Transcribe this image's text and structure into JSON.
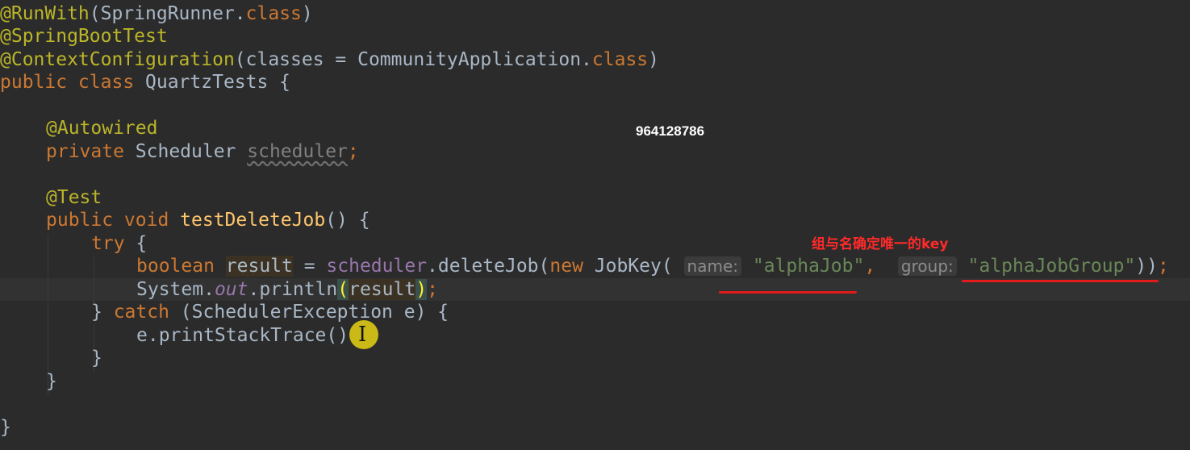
{
  "code": {
    "line1": {
      "annotation": "@RunWith",
      "open": "(SpringRunner.",
      "kw": "class",
      "close": ")"
    },
    "line2": {
      "annotation": "@SpringBootTest"
    },
    "line3": {
      "annotation": "@ContextConfiguration",
      "open": "(classes = CommunityApplication.",
      "kw": "class",
      "close": ")"
    },
    "line4": {
      "kw": "public class ",
      "name": "QuartzTests {"
    },
    "line6": {
      "annotation": "@Autowired"
    },
    "line7": {
      "kw": "private ",
      "type": "Scheduler ",
      "field": "scheduler",
      "semi": ";"
    },
    "line9": {
      "annotation": "@Test"
    },
    "line10": {
      "kw": "public void ",
      "method": "testDeleteJob",
      "rest": "() {"
    },
    "line11": {
      "kw": "try",
      "rest": " {"
    },
    "line12": {
      "kw": "boolean ",
      "var": "result",
      "eq": " = ",
      "field": "scheduler",
      "call": ".deleteJob(",
      "kw_new": "new ",
      "ctor": "JobKey( ",
      "hint_name": "name:",
      "str_name": "\"alphaJob\"",
      "comma": ",",
      "hint_group": "group:",
      "str_group": "\"alphaJobGroup\"",
      "close": "))",
      "semi": ";"
    },
    "line13": {
      "sys": "System.",
      "out": "out",
      "println": ".println",
      "lparen": "(",
      "arg": "result",
      "rparen": ")",
      "semi": ";"
    },
    "line14": {
      "brace": "} ",
      "kw": "catch",
      "rest": " (SchedulerException e) {"
    },
    "line15": {
      "call": "e.printStackTrace()"
    },
    "line16": {
      "brace": "}"
    },
    "line17": {
      "brace": "}"
    },
    "line19": {
      "brace": "}"
    }
  },
  "overlay": {
    "watermark": "964128786",
    "note": "组与名确定唯一的key"
  },
  "colors": {
    "background": "#2b2b2b",
    "annotation": "#bbb529",
    "keyword": "#cc7832",
    "string": "#6a8759",
    "field": "#9876aa",
    "method": "#ffc66d",
    "text": "#a9b7c6",
    "red_mark": "#e21b1b"
  }
}
